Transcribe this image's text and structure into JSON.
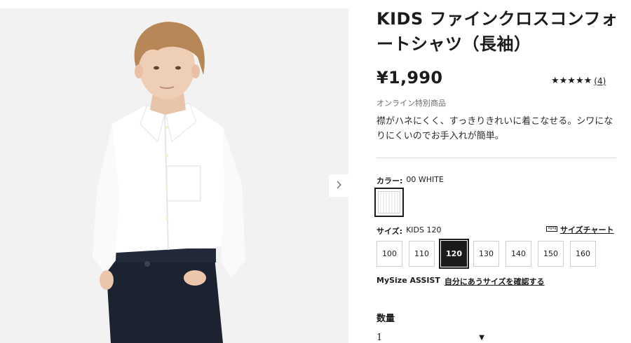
{
  "product": {
    "title": "KIDS ファインクロスコンフォートシャツ（長袖）",
    "price": "¥1,990",
    "rating": {
      "stars": 4.5,
      "stars_glyphs": "★★★★★",
      "count": "(4)"
    },
    "online_only": "オンライン特別商品",
    "description": "襟がハネにくく、すっきりきれいに着こなせる。シワになりにくいのでお手入れが簡単。"
  },
  "color": {
    "label": "カラー:",
    "selected": "00 WHITE",
    "swatch_color": "#ffffff"
  },
  "size": {
    "label": "サイズ:",
    "selected": "KIDS 120",
    "chart_label": "サイズチャート",
    "options": [
      "100",
      "110",
      "120",
      "130",
      "140",
      "150",
      "160"
    ],
    "selected_index": 2
  },
  "mysize": {
    "brand": "MySize ASSIST",
    "link": "自分にあうサイズを確認する"
  },
  "quantity": {
    "label": "数量",
    "value": "1"
  },
  "icons": {
    "carousel_next": "chevron-right-icon",
    "size_chart": "ruler-icon",
    "dropdown": "caret-down-icon"
  },
  "colors": {
    "text": "#1b1b1b",
    "muted": "#6b6b6b",
    "photo_bg": "#f2f2f2",
    "selected_size_bg": "#1b1b1b"
  }
}
